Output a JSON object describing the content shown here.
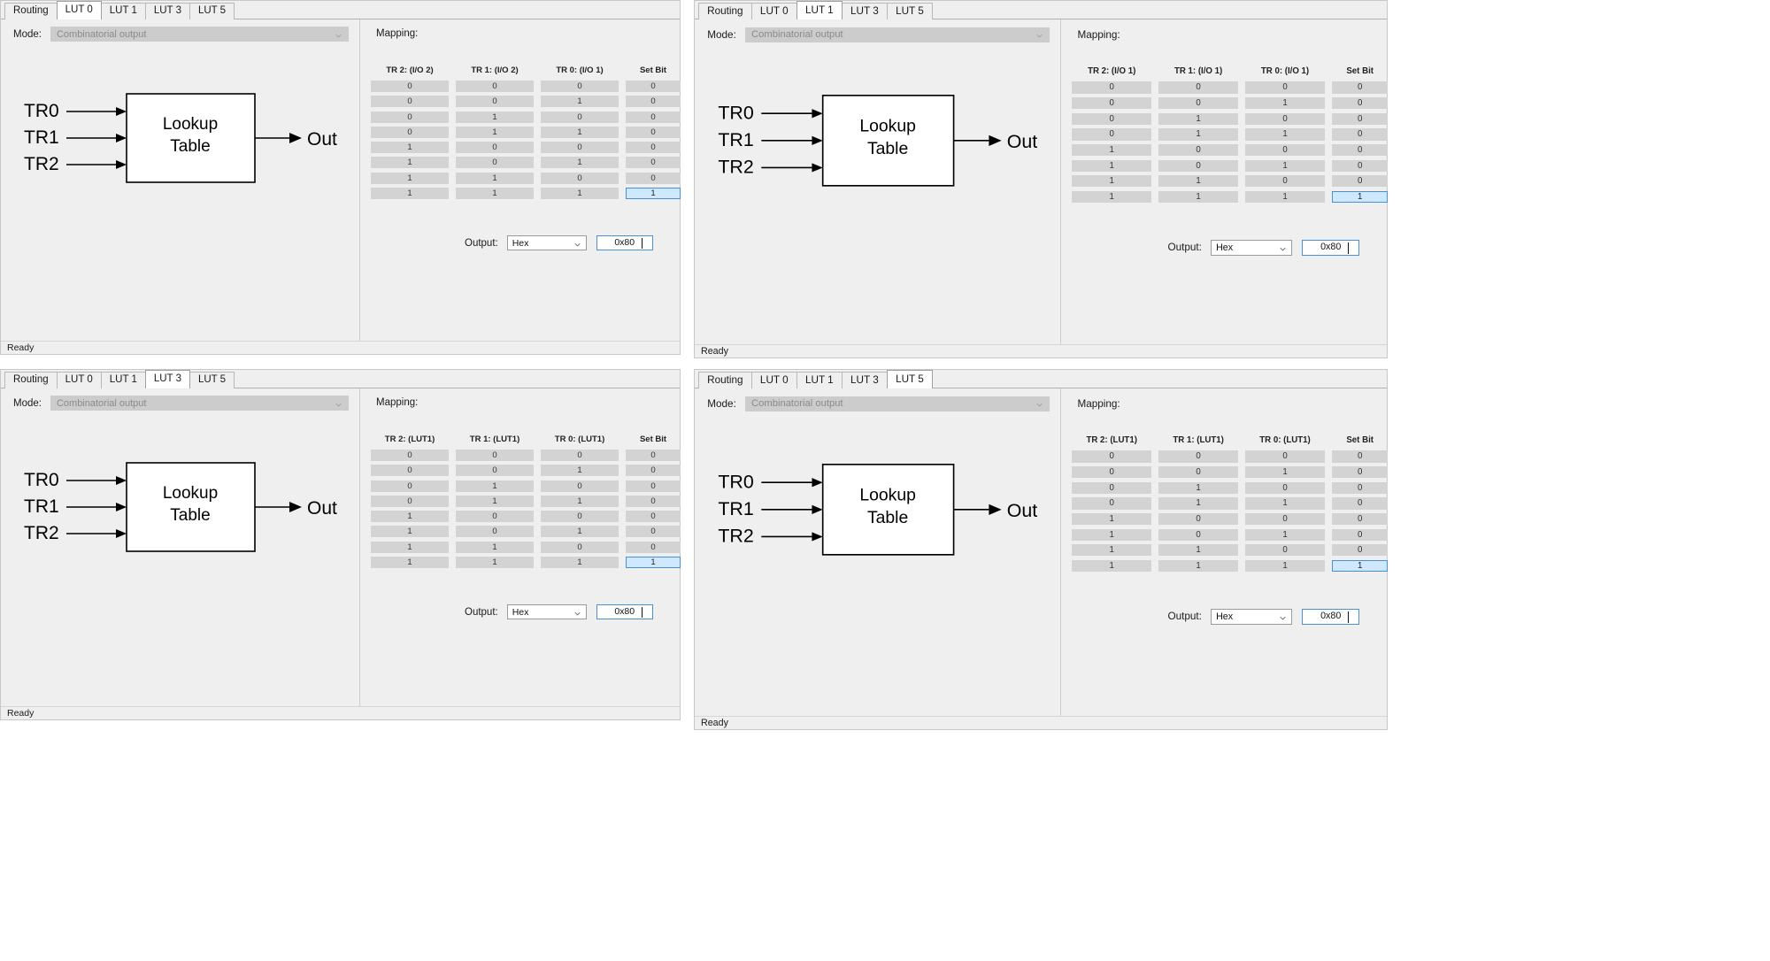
{
  "app": {
    "status_text": "Ready",
    "mode_label": "Mode:",
    "mode_value": "Combinatorial output",
    "mapping_label": "Mapping:",
    "output_label": "Output:",
    "setbit_header": "Set Bit",
    "output_format": "Hex",
    "output_value": "0x80",
    "diagram": {
      "input0": "TR0",
      "input1": "TR1",
      "input2": "TR2",
      "block_line1": "Lookup",
      "block_line2": "Table",
      "output": "Out"
    },
    "colors": {
      "window_bg": "#efefef",
      "cell_bg": "#d3d3d3",
      "highlight_bg": "#cde8ff",
      "highlight_border": "#4a90d9",
      "disabled_combo": "#cccccc",
      "text": "#1a1a1a"
    },
    "truth_table_values": [
      [
        "0",
        "0",
        "0",
        "0"
      ],
      [
        "0",
        "0",
        "1",
        "0"
      ],
      [
        "0",
        "1",
        "0",
        "0"
      ],
      [
        "0",
        "1",
        "1",
        "0"
      ],
      [
        "1",
        "0",
        "0",
        "0"
      ],
      [
        "1",
        "0",
        "1",
        "0"
      ],
      [
        "1",
        "1",
        "0",
        "0"
      ],
      [
        "1",
        "1",
        "1",
        "1"
      ]
    ],
    "setbit_active_row": 7
  },
  "panels": [
    {
      "id": "lut0",
      "tabs": [
        {
          "label": "Routing",
          "active": false
        },
        {
          "label": "LUT 0",
          "active": true
        },
        {
          "label": "LUT 1",
          "active": false
        },
        {
          "label": "LUT 3",
          "active": false
        },
        {
          "label": "LUT 5",
          "active": false
        }
      ],
      "columns": [
        "TR 2:  (I/O 2)",
        "TR 1:  (I/O 2)",
        "TR 0:  (I/O 1)"
      ]
    },
    {
      "id": "lut1",
      "tabs": [
        {
          "label": "Routing",
          "active": false
        },
        {
          "label": "LUT 0",
          "active": false
        },
        {
          "label": "LUT 1",
          "active": true
        },
        {
          "label": "LUT 3",
          "active": false
        },
        {
          "label": "LUT 5",
          "active": false
        }
      ],
      "columns": [
        "TR 2:  (I/O 1)",
        "TR 1:  (I/O 1)",
        "TR 0:  (I/O 1)"
      ]
    },
    {
      "id": "lut3",
      "tabs": [
        {
          "label": "Routing",
          "active": false
        },
        {
          "label": "LUT 0",
          "active": false
        },
        {
          "label": "LUT 1",
          "active": false
        },
        {
          "label": "LUT 3",
          "active": true
        },
        {
          "label": "LUT 5",
          "active": false
        }
      ],
      "columns": [
        "TR 2:  (LUT1)",
        "TR 1:  (LUT1)",
        "TR 0:  (LUT1)"
      ]
    },
    {
      "id": "lut5",
      "tabs": [
        {
          "label": "Routing",
          "active": false
        },
        {
          "label": "LUT 0",
          "active": false
        },
        {
          "label": "LUT 1",
          "active": false
        },
        {
          "label": "LUT 3",
          "active": false
        },
        {
          "label": "LUT 5",
          "active": true
        }
      ],
      "columns": [
        "TR 2:  (LUT1)",
        "TR 1:  (LUT1)",
        "TR 0:  (LUT1)"
      ]
    }
  ]
}
